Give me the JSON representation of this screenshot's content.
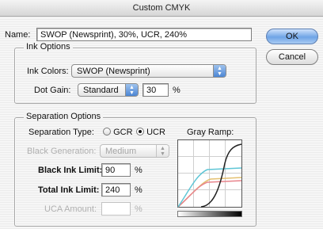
{
  "window": {
    "title": "Custom CMYK"
  },
  "name": {
    "label": "Name:",
    "value": "SWOP (Newsprint), 30%, UCR, 240%"
  },
  "buttons": {
    "ok": "OK",
    "cancel": "Cancel"
  },
  "ink_options": {
    "legend": "Ink Options",
    "ink_colors_label": "Ink Colors:",
    "ink_colors_value": "SWOP (Newsprint)",
    "dot_gain_label": "Dot Gain:",
    "dot_gain_mode": "Standard",
    "dot_gain_value": "30",
    "dot_gain_unit": "%"
  },
  "separation_options": {
    "legend": "Separation Options",
    "type_label": "Separation Type:",
    "gcr_label": "GCR",
    "ucr_label": "UCR",
    "selected": "UCR",
    "black_generation_label": "Black Generation:",
    "black_generation_value": "Medium",
    "black_ink_limit_label": "Black Ink Limit:",
    "black_ink_limit_value": "90",
    "black_ink_limit_unit": "%",
    "total_ink_limit_label": "Total Ink Limit:",
    "total_ink_limit_value": "240",
    "total_ink_limit_unit": "%",
    "uca_amount_label": "UCA Amount:",
    "uca_amount_value": "",
    "uca_amount_unit": "%",
    "gray_ramp_label": "Gray Ramp:"
  },
  "colors": {
    "cyan_curve": "#5fc6d6",
    "magenta_curve": "#e8848c",
    "yellow_curve": "#e4c070",
    "black_curve": "#222222"
  }
}
